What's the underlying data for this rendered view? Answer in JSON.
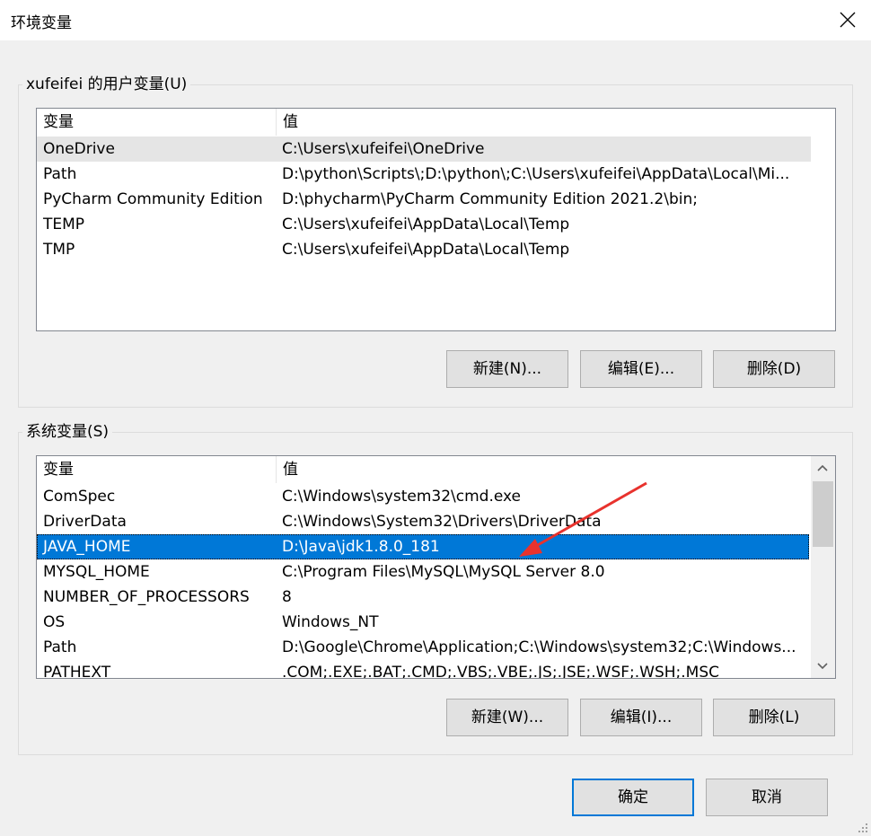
{
  "window": {
    "title": "环境变量",
    "close_icon": "close-icon"
  },
  "user_vars": {
    "group_label": "xufeifei 的用户变量(U)",
    "columns": [
      "变量",
      "值"
    ],
    "rows": [
      {
        "name": "OneDrive",
        "value": "C:\\Users\\xufeifei\\OneDrive"
      },
      {
        "name": "Path",
        "value": "D:\\python\\Scripts\\;D:\\python\\;C:\\Users\\xufeifei\\AppData\\Local\\Mi..."
      },
      {
        "name": "PyCharm Community Edition",
        "value": "D:\\phycharm\\PyCharm Community Edition 2021.2\\bin;"
      },
      {
        "name": "TEMP",
        "value": "C:\\Users\\xufeifei\\AppData\\Local\\Temp"
      },
      {
        "name": "TMP",
        "value": "C:\\Users\\xufeifei\\AppData\\Local\\Temp"
      }
    ],
    "hover_row": 0,
    "buttons": {
      "new": "新建(N)...",
      "edit": "编辑(E)...",
      "delete": "删除(D)"
    }
  },
  "system_vars": {
    "group_label": "系统变量(S)",
    "columns": [
      "变量",
      "值"
    ],
    "rows": [
      {
        "name": "ComSpec",
        "value": "C:\\Windows\\system32\\cmd.exe"
      },
      {
        "name": "DriverData",
        "value": "C:\\Windows\\System32\\Drivers\\DriverData"
      },
      {
        "name": "JAVA_HOME",
        "value": "D:\\Java\\jdk1.8.0_181"
      },
      {
        "name": "MYSQL_HOME",
        "value": "C:\\Program Files\\MySQL\\MySQL Server 8.0"
      },
      {
        "name": "NUMBER_OF_PROCESSORS",
        "value": "8"
      },
      {
        "name": "OS",
        "value": "Windows_NT"
      },
      {
        "name": "Path",
        "value": "D:\\Google\\Chrome\\Application;C:\\Windows\\system32;C:\\Windows..."
      },
      {
        "name": "PATHEXT",
        "value": ".COM;.EXE;.BAT;.CMD;.VBS;.VBE;.JS;.JSE;.WSF;.WSH;.MSC"
      }
    ],
    "selected_row": 2,
    "buttons": {
      "new": "新建(W)...",
      "edit": "编辑(I)...",
      "delete": "删除(L)"
    },
    "scroll_up_icon": "chevron-up-icon",
    "scroll_down_icon": "chevron-down-icon"
  },
  "footer": {
    "ok": "确定",
    "cancel": "取消"
  },
  "annotation": {
    "arrow_color": "#e8322d",
    "arrow_icon": "red-arrow-annotation"
  },
  "colors": {
    "selection": "#0078d7",
    "hover": "#e5e5e5",
    "default_border": "#0078d7"
  }
}
